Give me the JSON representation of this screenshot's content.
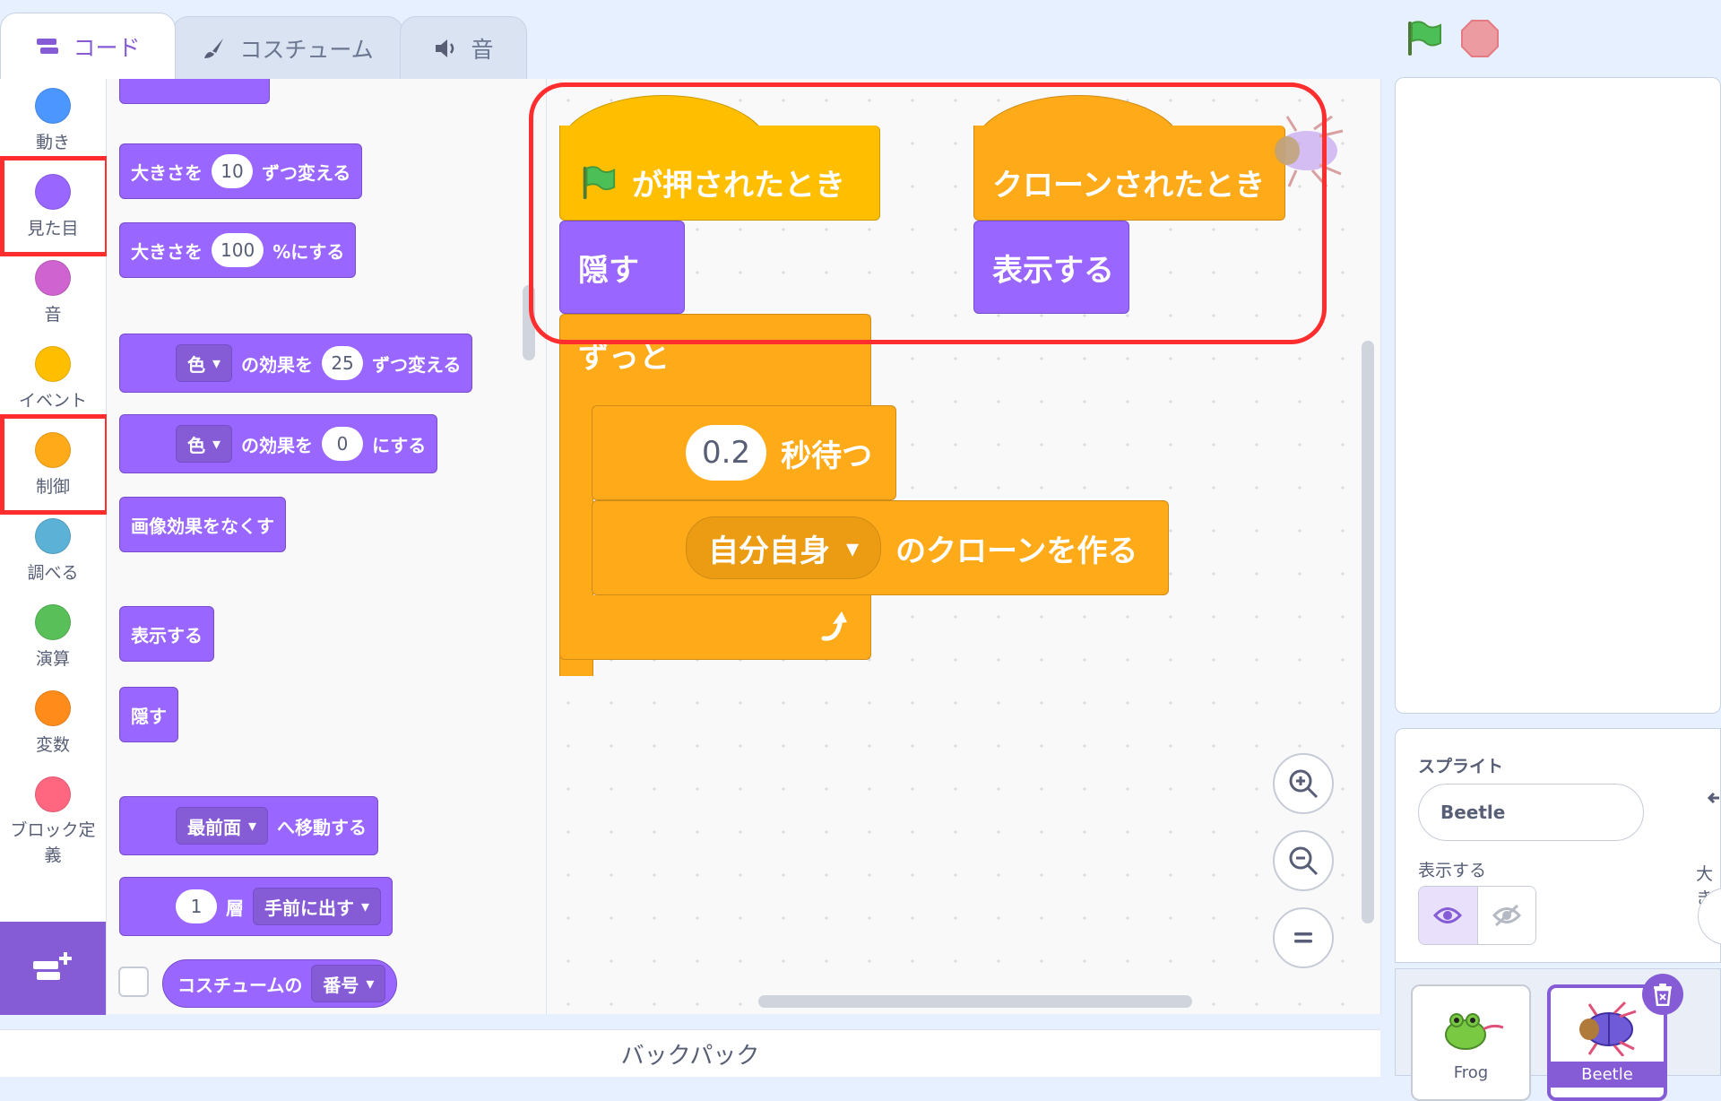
{
  "tabs": {
    "code": "コード",
    "costume": "コスチューム",
    "sound": "音"
  },
  "categories": [
    {
      "label": "動き",
      "color": "#4c97ff"
    },
    {
      "label": "見た目",
      "color": "#9966ff"
    },
    {
      "label": "音",
      "color": "#cf63cf"
    },
    {
      "label": "イベント",
      "color": "#ffbf00"
    },
    {
      "label": "制御",
      "color": "#ffab19"
    },
    {
      "label": "調べる",
      "color": "#5cb1d6"
    },
    {
      "label": "演算",
      "color": "#59c059"
    },
    {
      "label": "変数",
      "color": "#ff8c1a"
    },
    {
      "label": "ブロック定義",
      "color": "#ff6680"
    }
  ],
  "palette": {
    "change_size": {
      "text1": "大きさを",
      "value": "10",
      "text2": "ずつ変える"
    },
    "set_size": {
      "text1": "大きさを",
      "value": "100",
      "text2": "%にする"
    },
    "change_effect": {
      "effect": "色",
      "text1": "の効果を",
      "value": "25",
      "text2": "ずつ変える"
    },
    "set_effect": {
      "effect": "色",
      "text1": "の効果を",
      "value": "0",
      "text2": "にする"
    },
    "clear_effects": "画像効果をなくす",
    "show": "表示する",
    "hide": "隠す",
    "go_to_layer": {
      "layer": "最前面",
      "text": "へ移動する"
    },
    "go_layers": {
      "value": "1",
      "text": "層",
      "direction": "手前に出す"
    },
    "costume_reporter": {
      "text": "コスチュームの",
      "option": "番号"
    }
  },
  "workspace": {
    "flag_hat": "が押されたとき",
    "hide": "隠す",
    "forever": "ずっと",
    "wait": {
      "value": "0.2",
      "text": "秒待つ"
    },
    "create_clone": {
      "option": "自分自身",
      "text": "のクローンを作る"
    },
    "clone_hat": "クローンされたとき",
    "show": "表示する"
  },
  "backpack": "バックパック",
  "sprite_panel": {
    "title": "スプライト",
    "name_value": "Beetle",
    "show_label": "表示する",
    "size_label": "大き",
    "sprites": [
      {
        "name": "Frog",
        "selected": false
      },
      {
        "name": "Beetle",
        "selected": true
      }
    ]
  }
}
